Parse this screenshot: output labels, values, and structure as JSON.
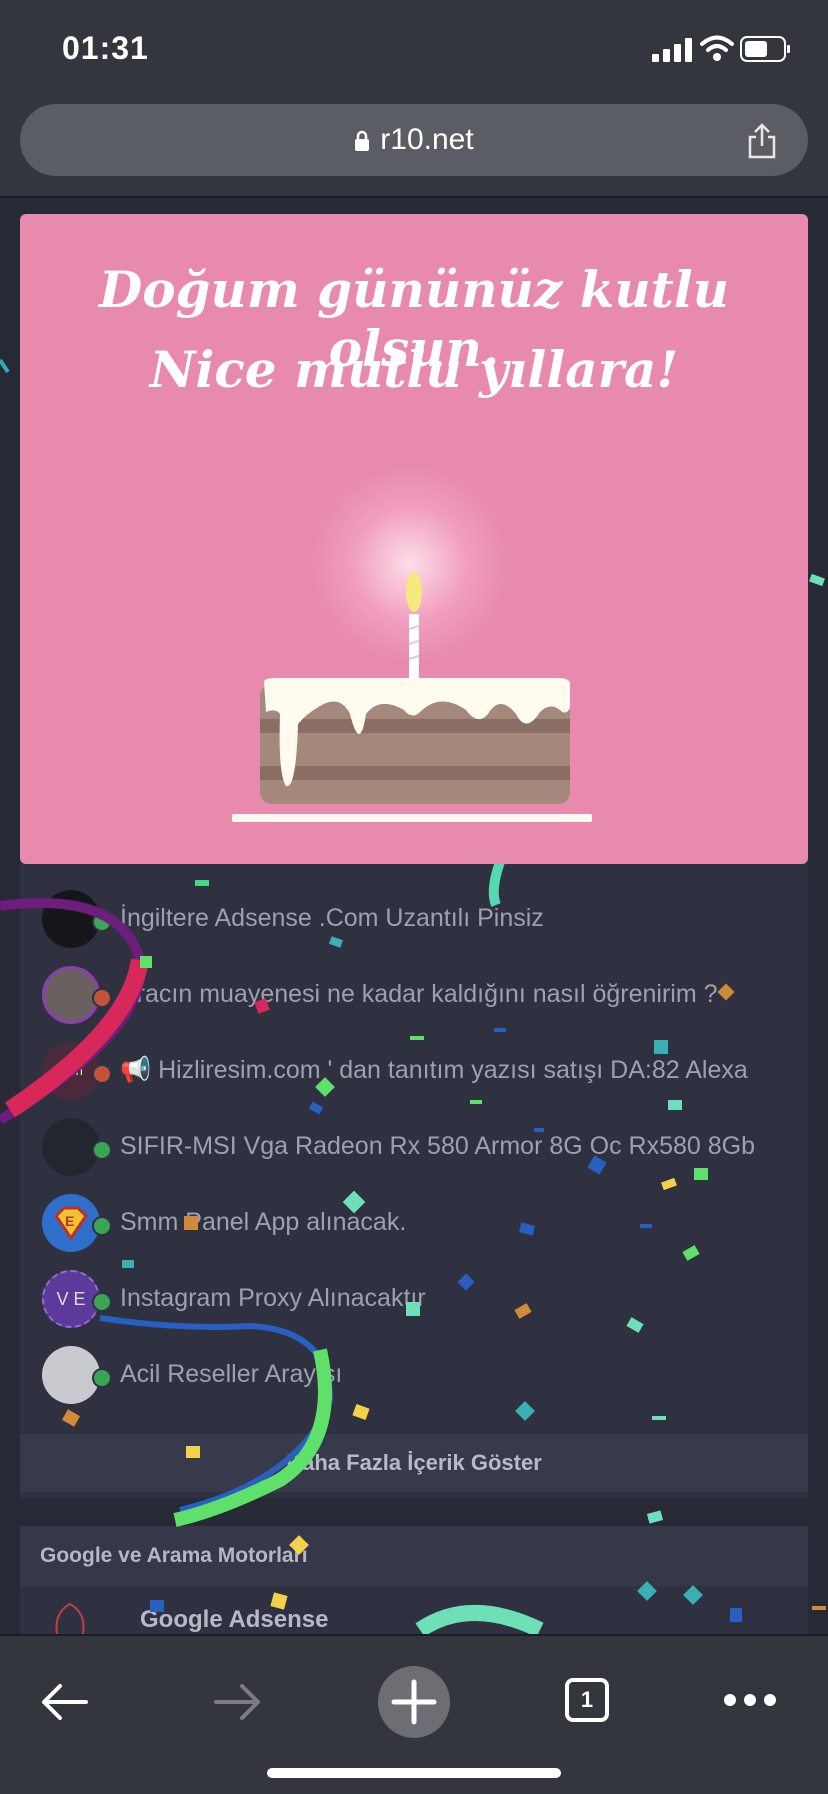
{
  "status_bar": {
    "time": "01:31"
  },
  "browser": {
    "url": "r10.net",
    "tab_count": "1"
  },
  "popup": {
    "line1": "Doğum gününüz kutlu olsun.",
    "line2": "Nice mutlu yıllara!"
  },
  "list": {
    "items": [
      {
        "title": "İngiltere Adsense .Com Uzantılı Pinsiz",
        "status_color": "#3aa655"
      },
      {
        "title": "Aracın muayenesi ne kadar kaldığını nasıl öğrenirim ?",
        "status_color": "#c0533a"
      },
      {
        "title": "📢 Hizliresim.com ' dan tanıtım yazısı satışı DA:82 Alexa",
        "status_color": "#c0533a"
      },
      {
        "title": "SIFIR-MSI Vga Radeon Rx 580 Armor 8G Oc Rx580 8Gb",
        "status_color": "#3aa655"
      },
      {
        "title": "Smm Panel App alınacak.",
        "status_color": "#3aa655"
      },
      {
        "title": "Instagram Proxy Alınacaktır",
        "status_color": "#3aa655"
      },
      {
        "title": "Acil Reseller Arayışı",
        "status_color": "#3aa655"
      }
    ],
    "more_button": "Daha Fazla İçerik Göster"
  },
  "section": {
    "title": "Google ve Arama Motorları",
    "subforum": "Google Adsense"
  },
  "avatar_text": {
    "ve": "V E",
    "ekin": "ekin"
  }
}
